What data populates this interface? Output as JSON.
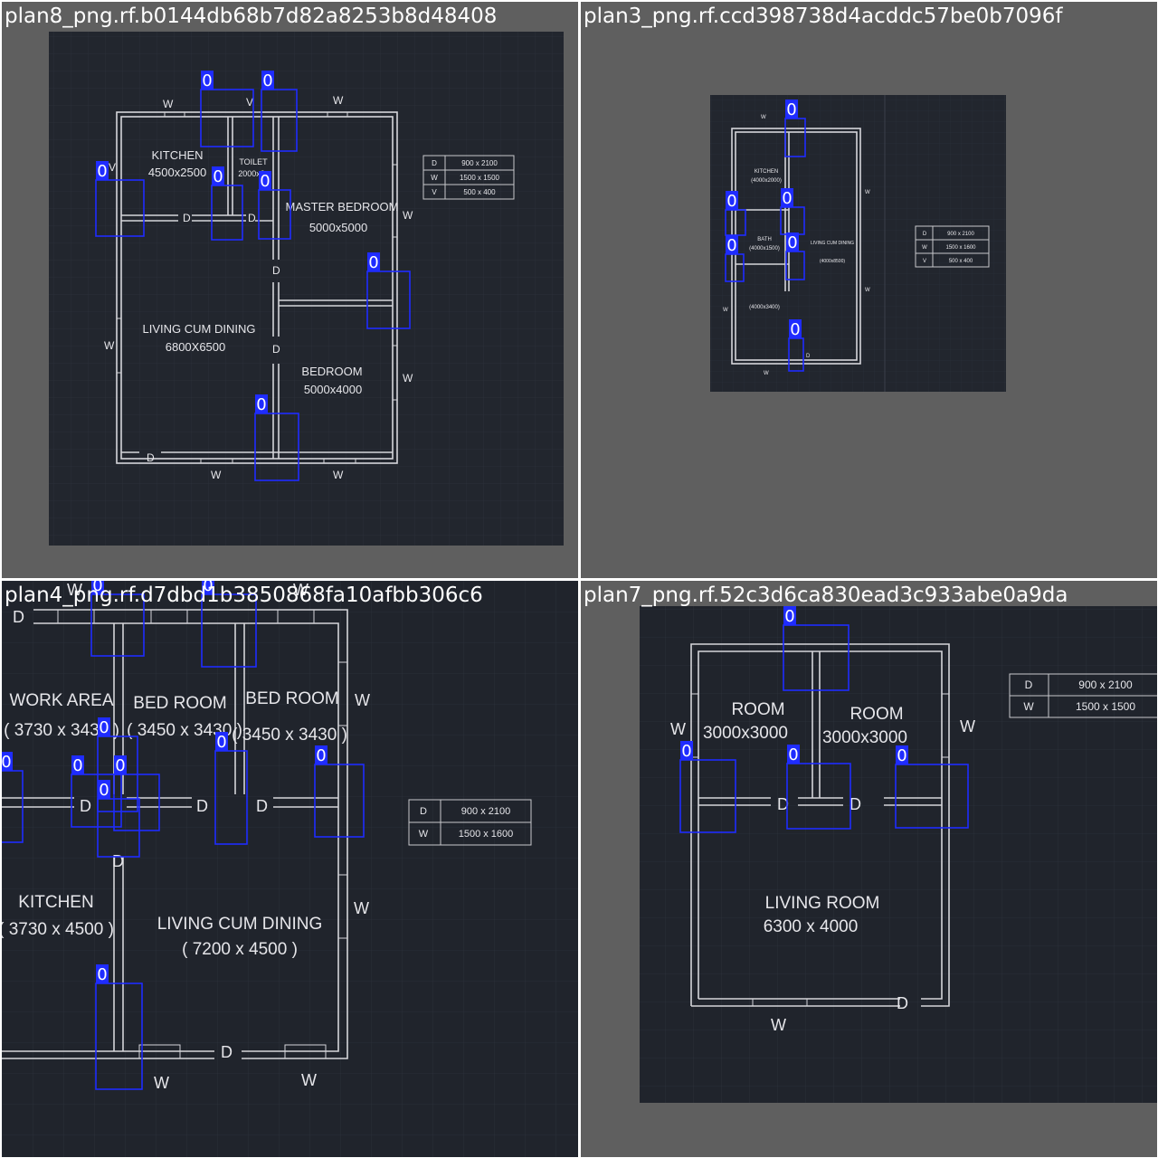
{
  "tiles": [
    {
      "caption": "plan8_png.rf.b0144db68b7d82a8253b8d48408",
      "rooms": [
        {
          "name": "KITCHEN",
          "size": "4500x2500"
        },
        {
          "name": "TOILET",
          "size": "2000x2"
        },
        {
          "name": "MASTER BEDROOM",
          "size": "5000x5000"
        },
        {
          "name": "LIVING CUM DINING",
          "size": "6800X6500"
        },
        {
          "name": "BEDROOM",
          "size": "5000x4000"
        }
      ],
      "marks": {
        "w": "W",
        "d": "D",
        "v": "V"
      },
      "schedule": [
        [
          "D",
          "900 x 2100"
        ],
        [
          "W",
          "1500 x 1500"
        ],
        [
          "V",
          "500 x 400"
        ]
      ],
      "detection_label": "0"
    },
    {
      "caption": "plan3_png.rf.ccd398738d4acddc57be0b7096f",
      "rooms": [
        {
          "name": "KITCHEN",
          "size": "(4000x2000)"
        },
        {
          "name": "BATH",
          "size": "(4000x1500)"
        },
        {
          "name": "LIVING CUM DINING",
          "size": "(4000x8500)"
        },
        {
          "name": "",
          "size": "(4000x3400)"
        }
      ],
      "marks": {
        "w": "W",
        "d": "D"
      },
      "schedule": [
        [
          "D",
          "900 x 2100"
        ],
        [
          "W",
          "1500 x 1600"
        ],
        [
          "V",
          "500 x 400"
        ]
      ],
      "detection_label": "0"
    },
    {
      "caption": "plan4_png.rf.d7dbd1b3850868fa10afbb306c6",
      "rooms": [
        {
          "name": "WORK AREA",
          "size": "( 3730 x 3430 )"
        },
        {
          "name": "BED ROOM",
          "size": "( 3450 x 3430 )"
        },
        {
          "name": "BED ROOM",
          "size": "( 3450 x 3430 )"
        },
        {
          "name": "KITCHEN",
          "size": "( 3730 x 4500 )"
        },
        {
          "name": "LIVING CUM DINING",
          "size": "( 7200 x 4500 )"
        }
      ],
      "marks": {
        "w": "W",
        "d": "D"
      },
      "schedule": [
        [
          "D",
          "900 x 2100"
        ],
        [
          "W",
          "1500 x 1600"
        ]
      ],
      "detection_label": "0"
    },
    {
      "caption": "plan7_png.rf.52c3d6ca830ead3c933abe0a9da",
      "rooms": [
        {
          "name": "ROOM",
          "size": "3000x3000"
        },
        {
          "name": "ROOM",
          "size": "3000x3000"
        },
        {
          "name": "LIVING ROOM",
          "size": "6300 x 4000"
        }
      ],
      "marks": {
        "w": "W",
        "d": "D"
      },
      "schedule": [
        [
          "D",
          "900 x 2100"
        ],
        [
          "W",
          "1500 x 1500"
        ]
      ],
      "detection_label": "0"
    }
  ],
  "colors": {
    "tile_background": "#5f5f5f",
    "cad_background": "#22262e",
    "cad_grid": "#2c313b",
    "cad_lines": "#d5d5da",
    "detection_box": "#1f2cff",
    "caption_text": "#ffffff"
  }
}
